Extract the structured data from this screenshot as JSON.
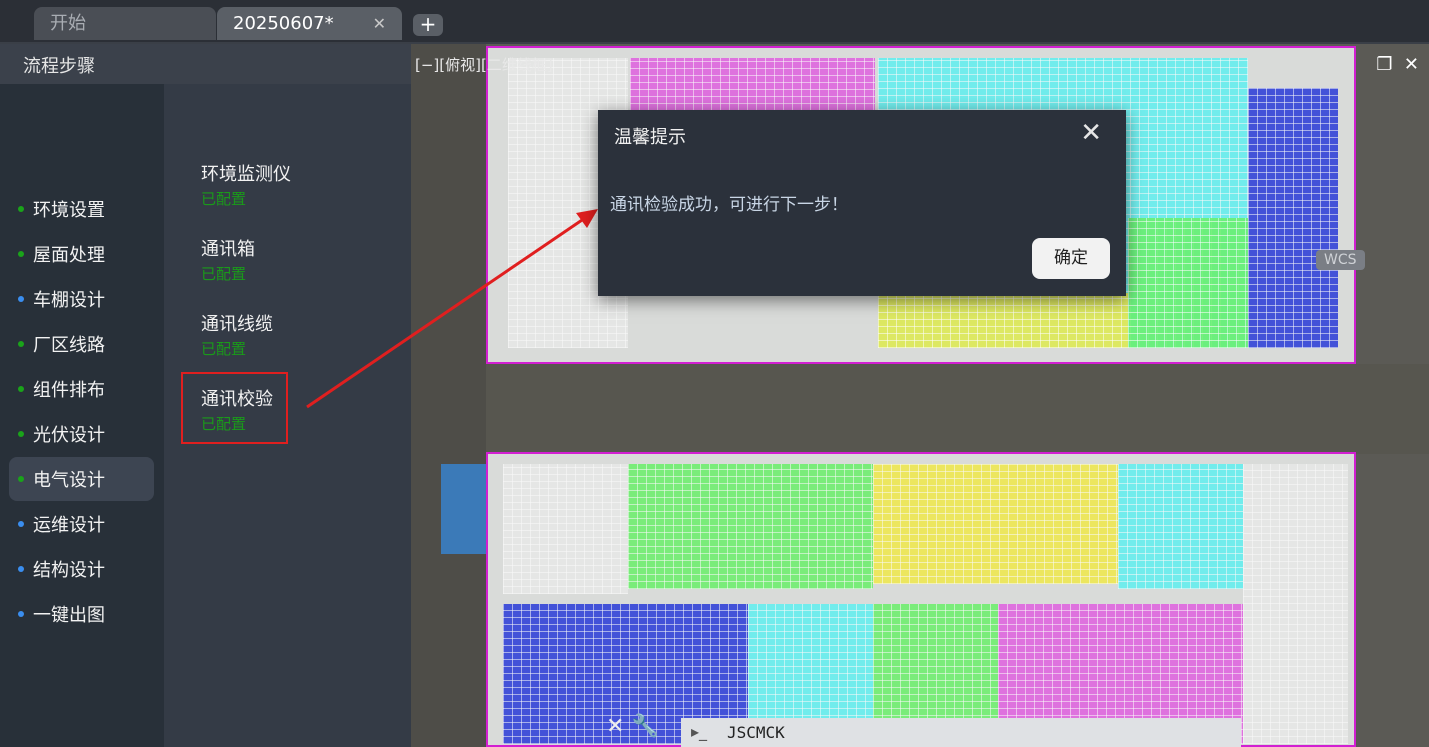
{
  "tabs": [
    {
      "label": "开始"
    },
    {
      "label": "20250607*",
      "close": "✕"
    }
  ],
  "new_tab": "+",
  "panel": {
    "title": "流程步骤",
    "nav": [
      {
        "label": "环境设置",
        "color": "#1aa31a"
      },
      {
        "label": "屋面处理",
        "color": "#1aa31a"
      },
      {
        "label": "车棚设计",
        "color": "#3a8ef0"
      },
      {
        "label": "厂区线路",
        "color": "#1aa31a"
      },
      {
        "label": "组件排布",
        "color": "#1aa31a"
      },
      {
        "label": "光伏设计",
        "color": "#1aa31a"
      },
      {
        "label": "电气设计",
        "color": "#1aa31a"
      },
      {
        "label": "运维设计",
        "color": "#3a8ef0"
      },
      {
        "label": "结构设计",
        "color": "#3a8ef0"
      },
      {
        "label": "一键出图",
        "color": "#3a8ef0"
      }
    ],
    "sub_items": [
      {
        "title": "环境监测仪",
        "status": "已配置"
      },
      {
        "title": "通讯箱",
        "status": "已配置"
      },
      {
        "title": "通讯线缆",
        "status": "已配置"
      },
      {
        "title": "通讯校验",
        "status": "已配置"
      }
    ]
  },
  "canvas": {
    "view_label": "[−][俯视][二维线框]",
    "wcs": "WCS",
    "command": "JSCMCK"
  },
  "dialog": {
    "title": "温馨提示",
    "message": "通讯检验成功，可进行下一步！",
    "ok": "确定"
  }
}
